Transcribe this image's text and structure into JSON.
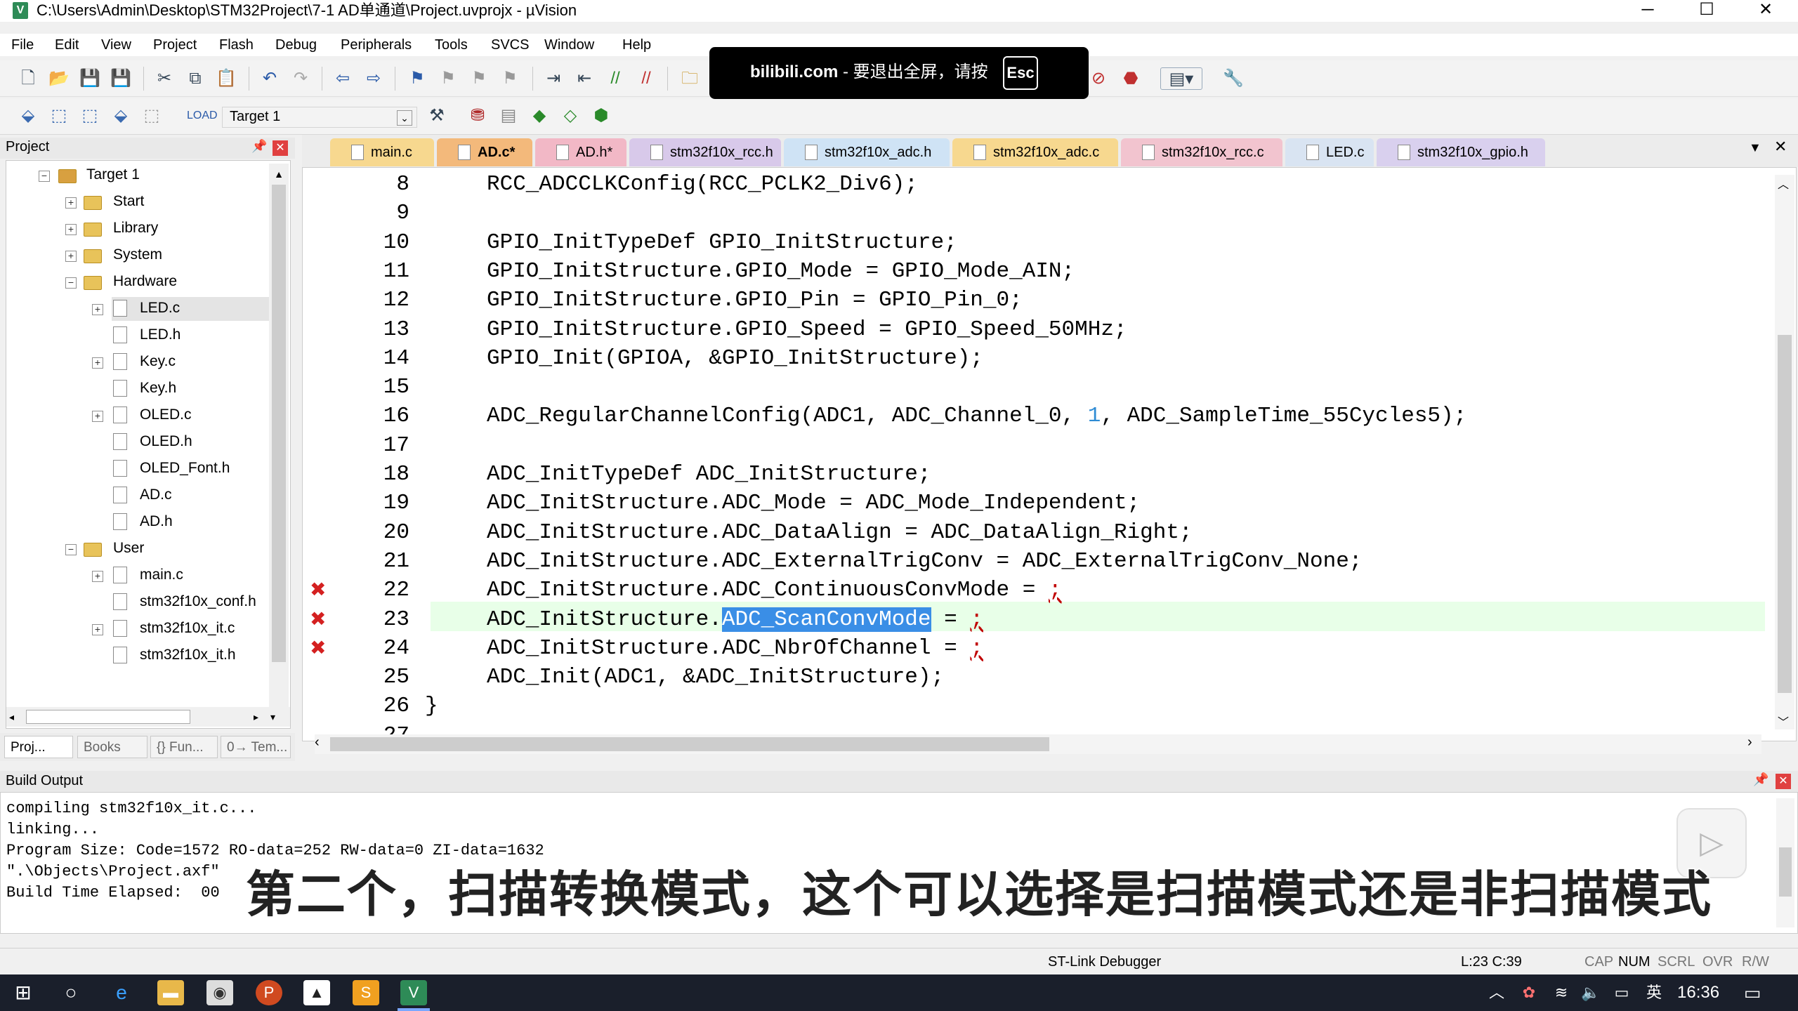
{
  "window": {
    "title": "C:\\Users\\Admin\\Desktop\\STM32Project\\7-1 AD单通道\\Project.uvprojx - µVision",
    "minimize": "─",
    "maximize": "☐",
    "close": "✕"
  },
  "menu": [
    "File",
    "Edit",
    "View",
    "Project",
    "Flash",
    "Debug",
    "Peripherals",
    "Tools",
    "SVCS",
    "Window",
    "Help"
  ],
  "overlay": {
    "site": "bilibili.com",
    "message": " - 要退出全屏，请按",
    "key": "Esc"
  },
  "toolbar2": {
    "target": "Target 1"
  },
  "project": {
    "header": "Project",
    "root": "Target 1",
    "groups": [
      {
        "name": "Start",
        "y": 0
      },
      {
        "name": "Library",
        "y": 0
      },
      {
        "name": "System",
        "y": 0
      }
    ],
    "hardware": "Hardware",
    "hardware_files": [
      "LED.c",
      "LED.h",
      "Key.c",
      "Key.h",
      "OLED.c",
      "OLED.h",
      "OLED_Font.h",
      "AD.c",
      "AD.h"
    ],
    "user": "User",
    "user_files": [
      "main.c",
      "stm32f10x_conf.h",
      "stm32f10x_it.c",
      "stm32f10x_it.h"
    ],
    "tabs": [
      "Proj...",
      "Books",
      "{} Fun...",
      "0→ Tem..."
    ]
  },
  "editor_tabs": [
    "main.c",
    "AD.c*",
    "AD.h*",
    "stm32f10x_rcc.h",
    "stm32f10x_adc.h",
    "stm32f10x_adc.c",
    "stm32f10x_rcc.c",
    "LED.c",
    "stm32f10x_gpio.h"
  ],
  "code": {
    "lines": [
      {
        "n": "8",
        "t": "RCC_ADCCLKConfig(RCC_PCLK2_Div6);"
      },
      {
        "n": "9",
        "t": ""
      },
      {
        "n": "10",
        "t": "GPIO_InitTypeDef GPIO_InitStructure;"
      },
      {
        "n": "11",
        "t": "GPIO_InitStructure.GPIO_Mode = GPIO_Mode_AIN;"
      },
      {
        "n": "12",
        "t": "GPIO_InitStructure.GPIO_Pin = GPIO_Pin_0;"
      },
      {
        "n": "13",
        "t": "GPIO_InitStructure.GPIO_Speed = GPIO_Speed_50MHz;"
      },
      {
        "n": "14",
        "t": "GPIO_Init(GPIOA, &GPIO_InitStructure);"
      },
      {
        "n": "15",
        "t": ""
      },
      {
        "n": "16",
        "a": "ADC_RegularChannelConfig(ADC1, ADC_Channel_0, ",
        "num": "1",
        "b": ", ADC_SampleTime_55Cycles5);"
      },
      {
        "n": "17",
        "t": ""
      },
      {
        "n": "18",
        "t": "ADC_InitTypeDef ADC_InitStructure;"
      },
      {
        "n": "19",
        "t": "ADC_InitStructure.ADC_Mode = ADC_Mode_Independent;"
      },
      {
        "n": "20",
        "t": "ADC_InitStructure.ADC_DataAlign = ADC_DataAlign_Right;"
      },
      {
        "n": "21",
        "t": "ADC_InitStructure.ADC_ExternalTrigConv = ADC_ExternalTrigConv_None;"
      },
      {
        "n": "22",
        "a": "ADC_InitStructure.ADC_ContinuousConvMode = ",
        "err": ";"
      },
      {
        "n": "23",
        "a": "ADC_InitStructure.",
        "sel": "ADC_ScanConvMode",
        "b": " = ",
        "err": ";"
      },
      {
        "n": "24",
        "a": "ADC_InitStructure.ADC_NbrOfChannel = ",
        "err": ";"
      },
      {
        "n": "25",
        "t": "ADC_Init(ADC1, &ADC_InitStructure);"
      },
      {
        "n": "26",
        "t": "}"
      },
      {
        "n": "27",
        "t": ""
      }
    ]
  },
  "build_output": {
    "header": "Build Output",
    "lines": [
      "compiling stm32f10x_it.c...",
      "linking...",
      "Program Size: Code=1572 RO-data=252 RW-data=0 ZI-data=1632",
      "\".\\Objects\\Project.axf\"",
      "Build Time Elapsed:  00"
    ],
    "subtitle": "第二个，扫描转换模式，这个可以选择是扫描模式还是非扫描模式"
  },
  "status": {
    "debugger": "ST-Link Debugger",
    "position": "L:23 C:39",
    "flags": [
      "CAP",
      "NUM",
      "SCRL",
      "OVR",
      "R/W"
    ]
  },
  "taskbar": {
    "ime": "英",
    "time": "16:36"
  },
  "colors": {
    "error": "#d42020",
    "selection": "#3a8ee6",
    "number": "#2e8bd4",
    "current_line": "#e8ffe8"
  }
}
